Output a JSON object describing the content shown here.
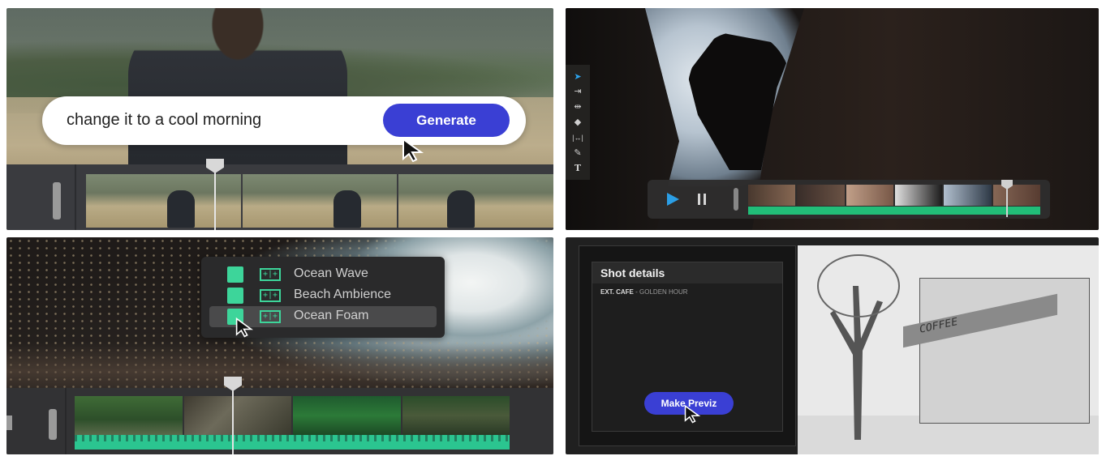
{
  "panel_prompt": {
    "prompt_text": "change it to a cool morning",
    "generate_label": "Generate"
  },
  "panel_editor": {
    "tools": [
      "selection-tool",
      "track-select-tool",
      "ripple-edit-tool",
      "razor-tool",
      "slip-tool",
      "pen-tool",
      "type-tool"
    ],
    "tool_glyphs": [
      "➤",
      "⇥",
      "⇹",
      "◆",
      "|↔|",
      "✎",
      "T"
    ]
  },
  "panel_sounds": {
    "items": [
      {
        "label": "Ocean Wave",
        "active": false
      },
      {
        "label": "Beach Ambience",
        "active": false
      },
      {
        "label": "Ocean Foam",
        "active": true
      }
    ]
  },
  "panel_previz": {
    "title": "Shot details",
    "scene_prefix": "EXT. CAFE",
    "scene_suffix": " - GOLDEN HOUR",
    "button_label": "Make Previz",
    "sign_text": "COFFEE"
  },
  "colors": {
    "accent_button": "#3a3fd4",
    "audio_green": "#3dd59a",
    "play_blue": "#2ca4ee"
  }
}
